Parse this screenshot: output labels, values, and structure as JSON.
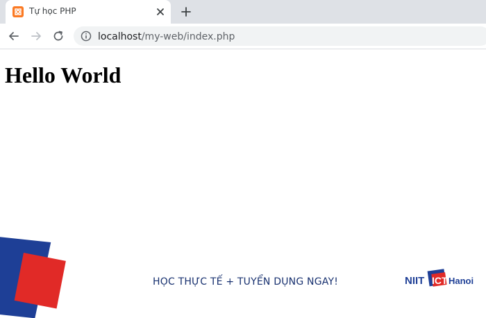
{
  "browser": {
    "tab": {
      "title": "Tự học PHP",
      "favicon_color": "#fb7a24"
    },
    "address_bar": {
      "host": "localhost",
      "path": "/my-web/index.php"
    }
  },
  "page": {
    "heading": "Hello World"
  },
  "banner": {
    "tagline": "HỌC THỰC TẾ + TUYỂN DỤNG NGAY!",
    "logo": {
      "left": "NIIT",
      "middle": "ICT",
      "right": "Hanoi"
    },
    "colors": {
      "blue": "#1e3f96",
      "red": "#e12a27"
    }
  }
}
